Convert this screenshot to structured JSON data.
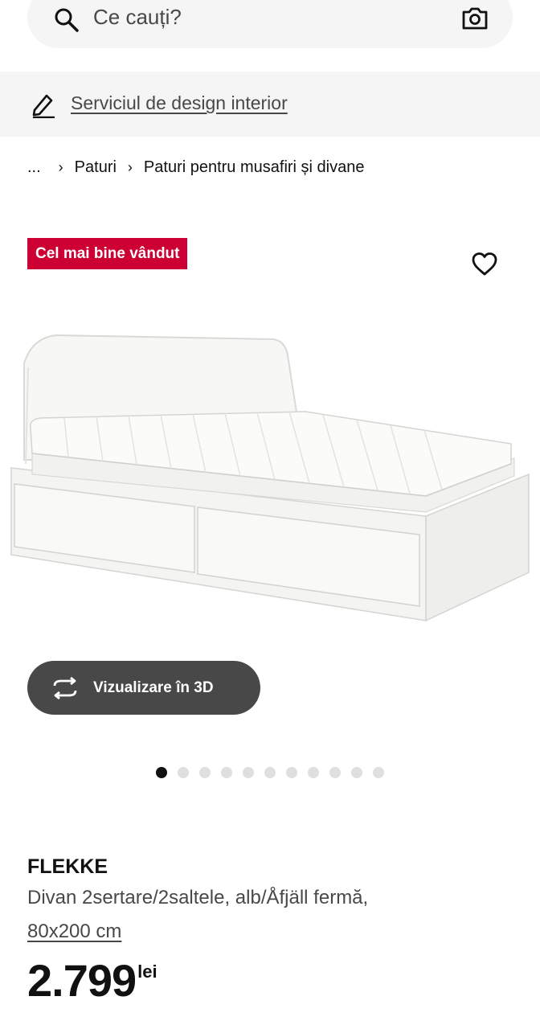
{
  "search": {
    "placeholder": "Ce cauți?"
  },
  "design_service": {
    "link_text": "Serviciul de design interior"
  },
  "breadcrumb": {
    "ellipsis": "...",
    "items": [
      "Paturi",
      "Paturi pentru musafiri și divane"
    ]
  },
  "product": {
    "badge": "Cel mai bine vândut",
    "view_3d_label": "Vizualizare în 3D",
    "image_count": 11,
    "active_image": 1,
    "name": "FLEKKE",
    "description": "Divan 2sertare/2saltele, alb/Åfjäll fermă,",
    "size": "80x200 cm",
    "price": "2.799",
    "currency": "lei"
  },
  "colors": {
    "badge": "#cc0033",
    "button_3d": "#484848",
    "background_bar": "#f5f5f5"
  },
  "icons": [
    "search-icon",
    "camera-icon",
    "pencil-icon",
    "heart-icon",
    "rotate-icon"
  ]
}
